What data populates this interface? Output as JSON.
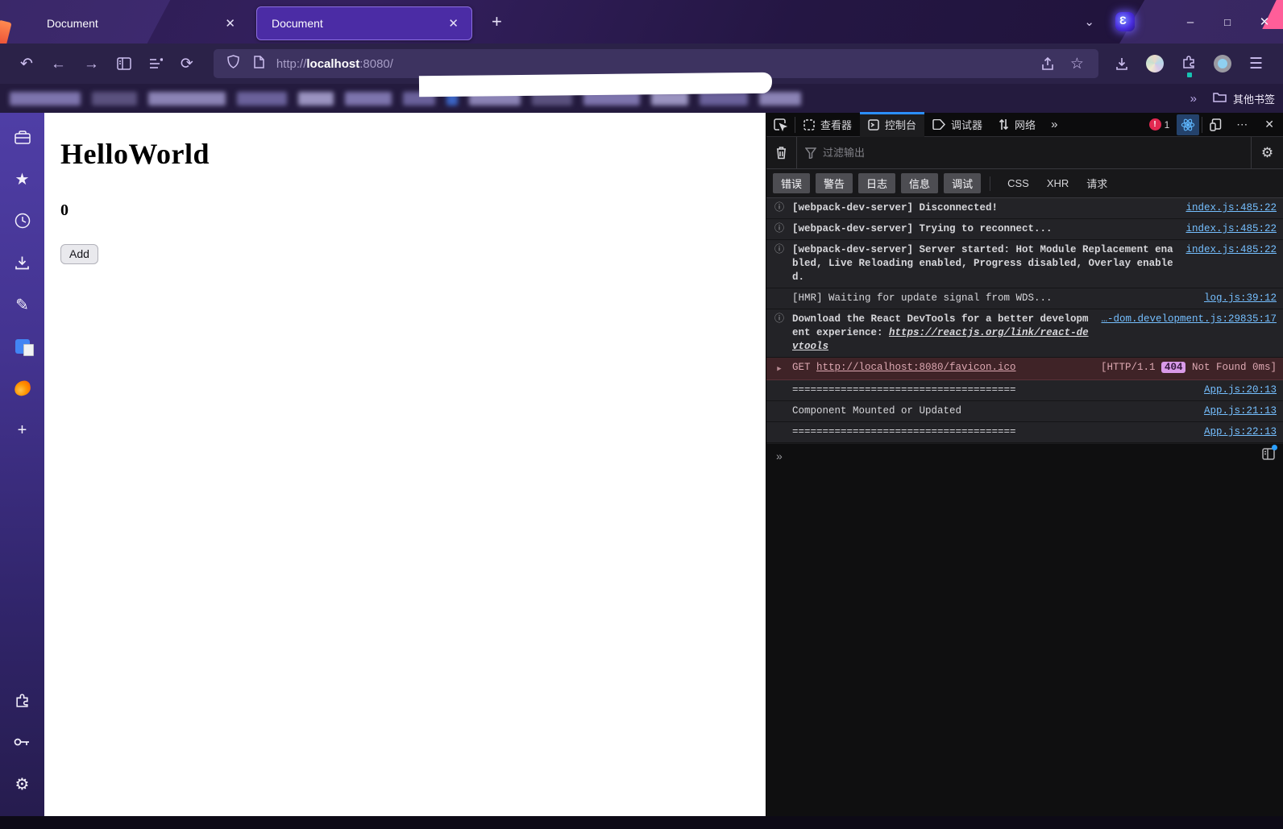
{
  "window": {
    "tabs": [
      {
        "title": "Document"
      },
      {
        "title": "Document"
      }
    ],
    "close_glyph": "✕",
    "new_tab_glyph": "+",
    "minimize_glyph": "–",
    "maximize_glyph": "□"
  },
  "navbar": {
    "url_scheme": "http://",
    "url_host": "localhost",
    "url_rest": ":8080/"
  },
  "bookmarks": {
    "overflow_glyph": "»",
    "other_bookmarks_label": "其他书签"
  },
  "page": {
    "heading": "HelloWorld",
    "counter": "0",
    "add_button_label": "Add"
  },
  "devtools": {
    "tabs": [
      {
        "label": "查看器"
      },
      {
        "label": "控制台"
      },
      {
        "label": "调试器"
      },
      {
        "label": "网络"
      }
    ],
    "more_tabs_glyph": "»",
    "error_badge_count": "1",
    "meatball_glyph": "⋯",
    "close_glyph": "✕",
    "filter_placeholder": "过滤输出",
    "filter_buttons": [
      "错误",
      "警告",
      "日志",
      "信息",
      "调试"
    ],
    "filter_text_buttons": [
      "CSS",
      "XHR",
      "请求"
    ],
    "prompt_glyph": "»",
    "accent_blue": "#2b8fff",
    "link_blue": "#75bfff",
    "error_red": "#e22850",
    "messages": [
      {
        "type": "info",
        "text": "[webpack-dev-server] Disconnected!",
        "source": "index.js:485:22"
      },
      {
        "type": "info",
        "text": "[webpack-dev-server] Trying to reconnect...",
        "source": "index.js:485:22"
      },
      {
        "type": "info",
        "text": "[webpack-dev-server] Server started: Hot Module Replacement enabled, Live Reloading enabled, Progress disabled, Overlay enabled.",
        "source": "index.js:485:22"
      },
      {
        "type": "log",
        "text": "[HMR] Waiting for update signal from WDS...",
        "source": "log.js:39:12"
      },
      {
        "type": "info",
        "text": "Download the React DevTools for a better development experience: ",
        "link": "https://reactjs.org/link/react-devtools",
        "source": "…-dom.development.js:29835:17"
      },
      {
        "type": "net",
        "method": "GET ",
        "url": "http://localhost:8080/favicon.ico",
        "status_prefix": "[HTTP/1.1 ",
        "status_code": "404",
        "status_suffix": " Not Found 0ms]"
      },
      {
        "type": "log",
        "text": "=====================================",
        "source": "App.js:20:13"
      },
      {
        "type": "log",
        "text": "Component Mounted or Updated",
        "source": "App.js:21:13"
      },
      {
        "type": "log",
        "text": "=====================================",
        "source": "App.js:22:13"
      }
    ]
  }
}
